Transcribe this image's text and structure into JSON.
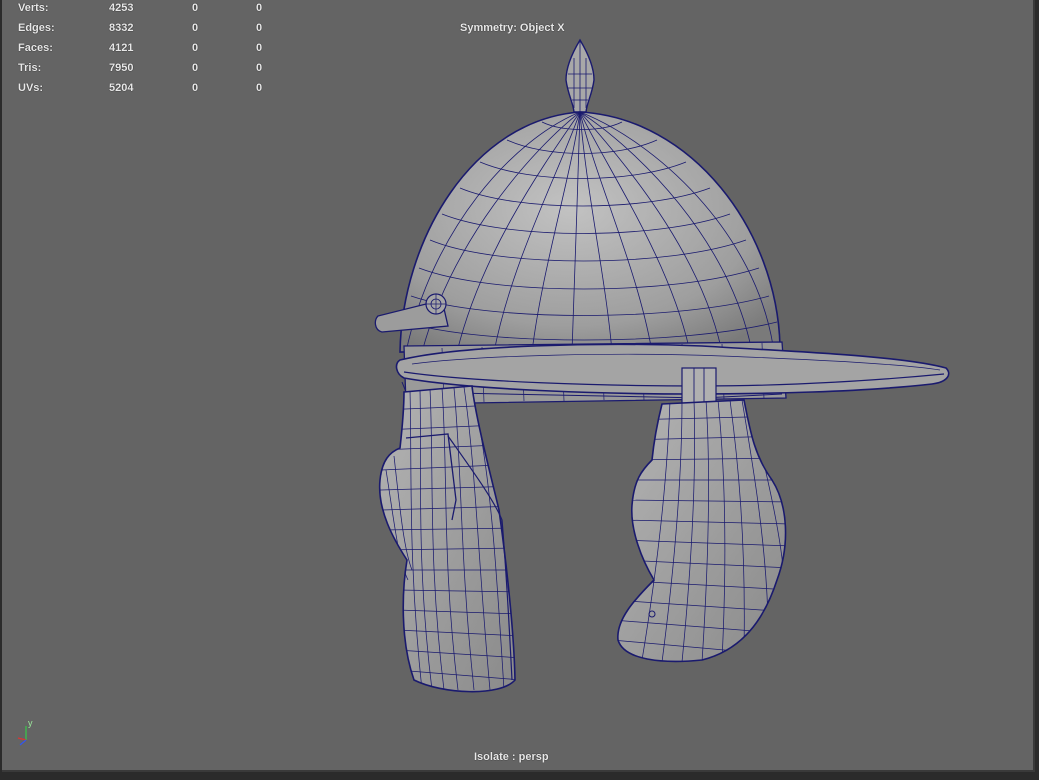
{
  "hud": {
    "rows": [
      {
        "label": "Verts:",
        "v1": "4253",
        "v2": "0",
        "v3": "0"
      },
      {
        "label": "Edges:",
        "v1": "8332",
        "v2": "0",
        "v3": "0"
      },
      {
        "label": "Faces:",
        "v1": "4121",
        "v2": "0",
        "v3": "0"
      },
      {
        "label": "Tris:",
        "v1": "7950",
        "v2": "0",
        "v3": "0"
      },
      {
        "label": "UVs:",
        "v1": "5204",
        "v2": "0",
        "v3": "0"
      }
    ]
  },
  "viewport": {
    "symmetry": "Symmetry: Object X",
    "camera": "Isolate : persp",
    "axis_label": "y",
    "background": "#646464",
    "wire_color": "#1a1a6e",
    "model_icon": "helmet-mesh"
  }
}
